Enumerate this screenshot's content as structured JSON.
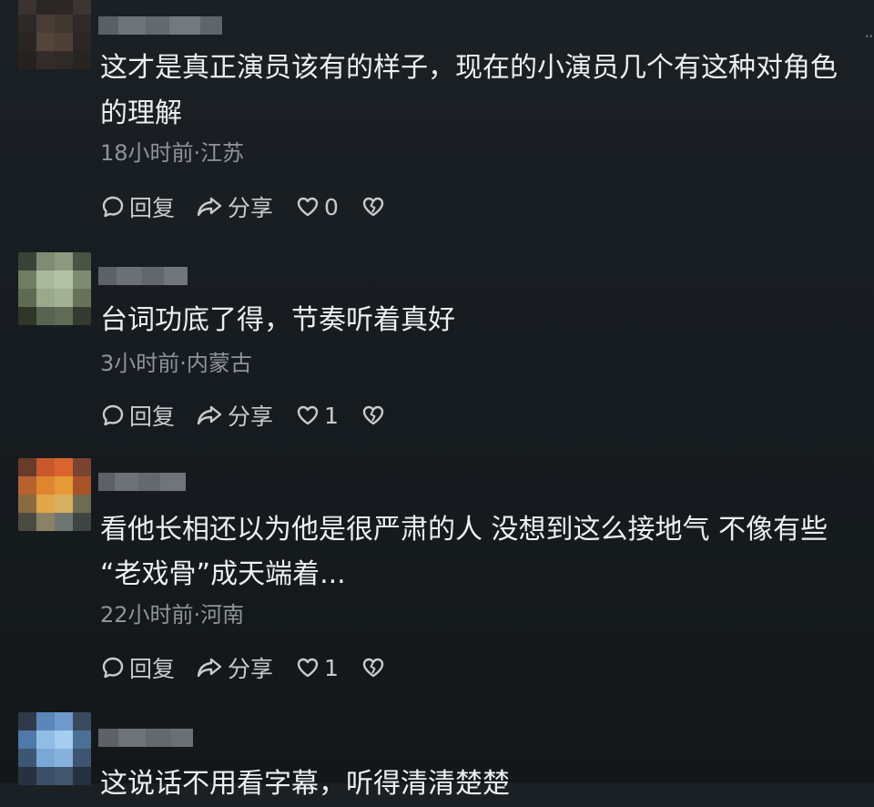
{
  "comments": [
    {
      "text_lines": [
        "这才是真正演员该有的样子，现在的小演员几个有这种对角色",
        "的理解"
      ],
      "meta": "18小时前·江苏",
      "reply_label": "回复",
      "share_label": "分享",
      "like_count": "0"
    },
    {
      "text_lines": [
        "台词功底了得，节奏听着真好"
      ],
      "meta": "3小时前·内蒙古",
      "reply_label": "回复",
      "share_label": "分享",
      "like_count": "1"
    },
    {
      "text_lines": [
        "看他长相还以为他是很严肃的人 没想到这么接地气 不像有些",
        "“老戏骨”成天端着..."
      ],
      "meta": "22小时前·河南",
      "reply_label": "回复",
      "share_label": "分享",
      "like_count": "1"
    },
    {
      "text_lines": [
        "这说话不用看字幕，听得清清楚楚"
      ]
    }
  ],
  "top_right_glyph": "··",
  "icons": {
    "reply": "comment-bubble-icon",
    "share": "share-arrow-icon",
    "like": "heart-icon",
    "dislike": "broken-heart-icon"
  },
  "colors": {
    "background": "#181d21",
    "text": "#eceef0",
    "meta": "#8e9499",
    "action": "#c7cbce"
  }
}
